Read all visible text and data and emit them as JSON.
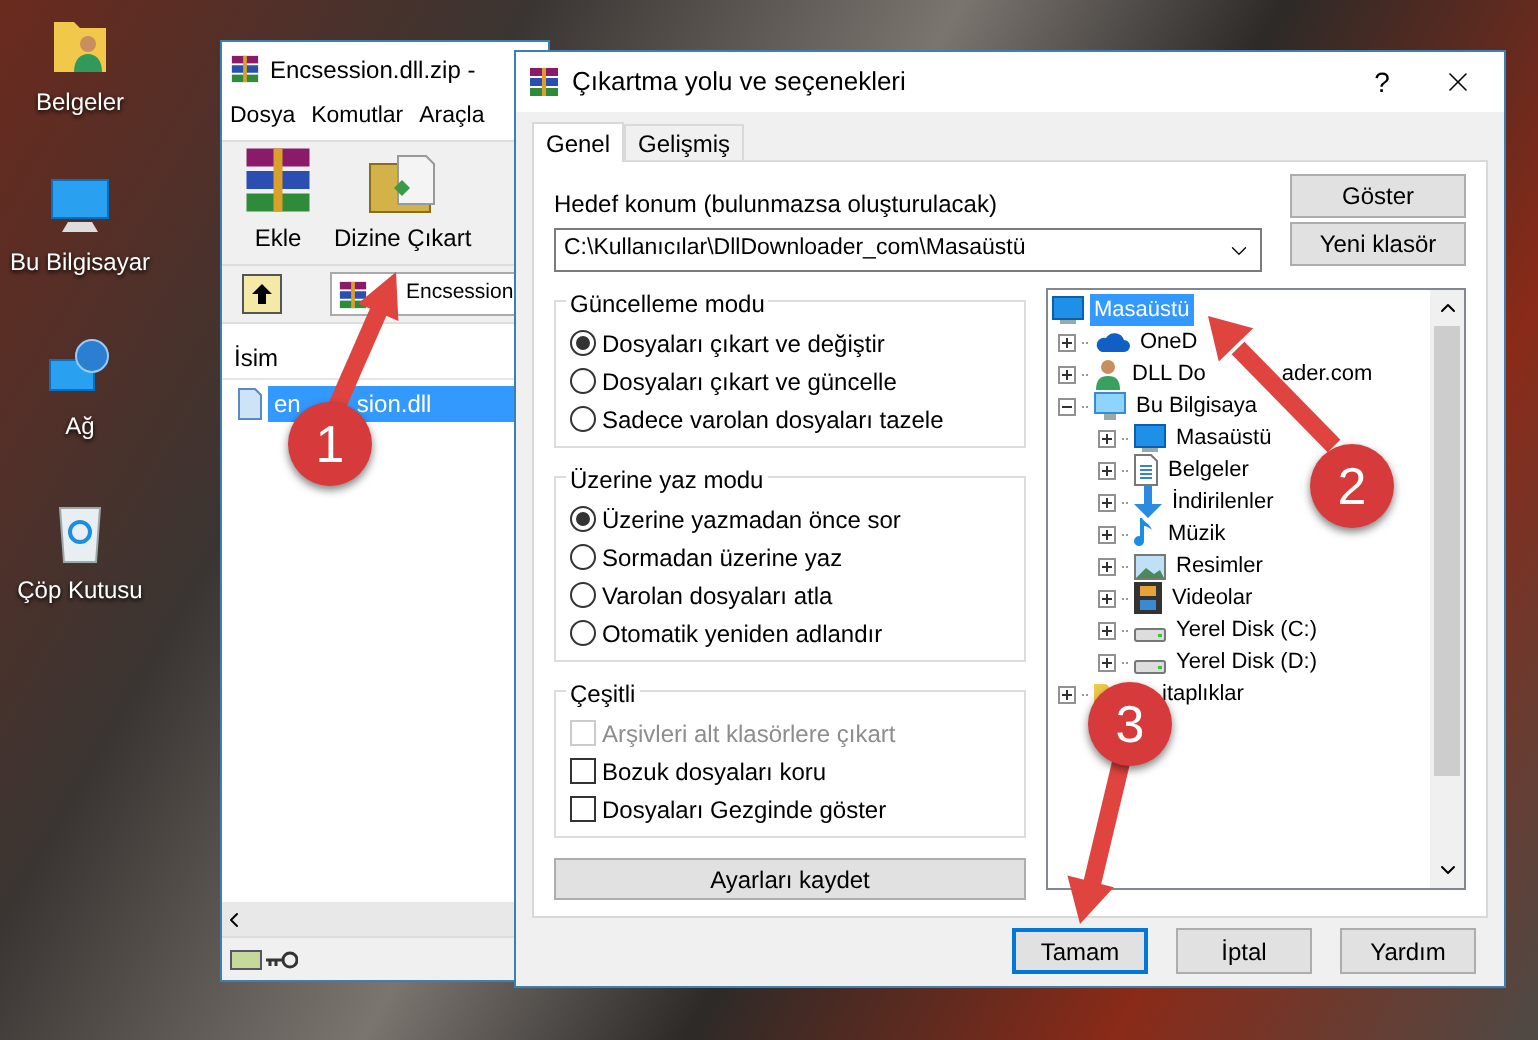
{
  "desktop_icons": [
    {
      "label": "Belgeler",
      "kind": "folder-user"
    },
    {
      "label": "Bu Bilgisayar",
      "kind": "computer"
    },
    {
      "label": "Ağ",
      "kind": "network"
    },
    {
      "label": "Çöp Kutusu",
      "kind": "recycle"
    }
  ],
  "archive_window": {
    "title": "Encsession.dll.zip -",
    "menu": [
      "Dosya",
      "Komutlar",
      "Araçla"
    ],
    "toolbar": [
      {
        "label": "Ekle",
        "kind": "add"
      },
      {
        "label": "Dizine Çıkart",
        "kind": "extract"
      }
    ],
    "address": "Encsession",
    "columns": [
      "İsim"
    ],
    "files": [
      {
        "name": "en",
        "name_tail": "sion.dll",
        "selected": true
      }
    ]
  },
  "dialog": {
    "title": "Çıkartma yolu ve seçenekleri",
    "help": "?",
    "tabs": [
      {
        "label": "Genel",
        "selected": true
      },
      {
        "label": "Gelişmiş",
        "selected": false
      }
    ],
    "destination_label": "Hedef konum (bulunmazsa oluşturulacak)",
    "destination_value": "C:\\Kullanıcılar\\DllDownloader_com\\Masaüstü",
    "side_buttons": [
      "Göster",
      "Yeni klasör"
    ],
    "groups": [
      {
        "title": "Güncelleme modu",
        "options": [
          {
            "kind": "radio",
            "label": "Dosyaları çıkart ve değiştir",
            "selected": true
          },
          {
            "kind": "radio",
            "label": "Dosyaları çıkart ve güncelle",
            "selected": false
          },
          {
            "kind": "radio",
            "label": "Sadece varolan dosyaları tazele",
            "selected": false
          }
        ]
      },
      {
        "title": "Üzerine yaz modu",
        "options": [
          {
            "kind": "radio",
            "label": "Üzerine yazmadan önce sor",
            "selected": true
          },
          {
            "kind": "radio",
            "label": "Sormadan üzerine yaz",
            "selected": false
          },
          {
            "kind": "radio",
            "label": "Varolan dosyaları atla",
            "selected": false
          },
          {
            "kind": "radio",
            "label": "Otomatik yeniden adlandır",
            "selected": false
          }
        ]
      },
      {
        "title": "Çeşitli",
        "options": [
          {
            "kind": "checkbox",
            "label": "Arşivleri alt klasörlere çıkart",
            "checked": false,
            "disabled": true
          },
          {
            "kind": "checkbox",
            "label": "Bozuk dosyaları koru",
            "checked": false,
            "disabled": false
          },
          {
            "kind": "checkbox",
            "label": "Dosyaları Gezginde göster",
            "checked": false,
            "disabled": false
          }
        ]
      }
    ],
    "save_button": "Ayarları kaydet",
    "tree": [
      {
        "label": "Masaüstü",
        "kind": "desktop",
        "selected": true,
        "children": [
          {
            "label": "OneD",
            "kind": "cloud",
            "selected": false,
            "expanded": false
          },
          {
            "label": "DLL Do",
            "label_tail": "ader.com",
            "kind": "user",
            "selected": false,
            "expanded": false
          },
          {
            "label": "Bu Bilgisaya",
            "kind": "computer",
            "selected": false,
            "expanded": true,
            "children": [
              {
                "label": "Masaüstü",
                "kind": "desktop",
                "selected": false,
                "expanded": false
              },
              {
                "label": "Belgeler",
                "kind": "document",
                "selected": false,
                "expanded": false
              },
              {
                "label": "İndirilenler",
                "kind": "download",
                "selected": false,
                "expanded": false
              },
              {
                "label": "Müzik",
                "kind": "music",
                "selected": false,
                "expanded": false
              },
              {
                "label": "Resimler",
                "kind": "picture",
                "selected": false,
                "expanded": false
              },
              {
                "label": "Videolar",
                "kind": "video",
                "selected": false,
                "expanded": false
              },
              {
                "label": "Yerel Disk (C:)",
                "kind": "drive",
                "selected": false,
                "expanded": false
              },
              {
                "label": "Yerel Disk (D:)",
                "kind": "drive",
                "selected": false,
                "expanded": false
              }
            ]
          },
          {
            "label_tail": "itaplıklar",
            "kind": "folder",
            "selected": false,
            "expanded": false
          }
        ]
      }
    ],
    "buttons": [
      {
        "label": "Tamam",
        "default": true
      },
      {
        "label": "İptal",
        "default": false
      },
      {
        "label": "Yardım",
        "default": false
      }
    ]
  },
  "annotations": [
    {
      "number": "1"
    },
    {
      "number": "2"
    },
    {
      "number": "3"
    }
  ]
}
